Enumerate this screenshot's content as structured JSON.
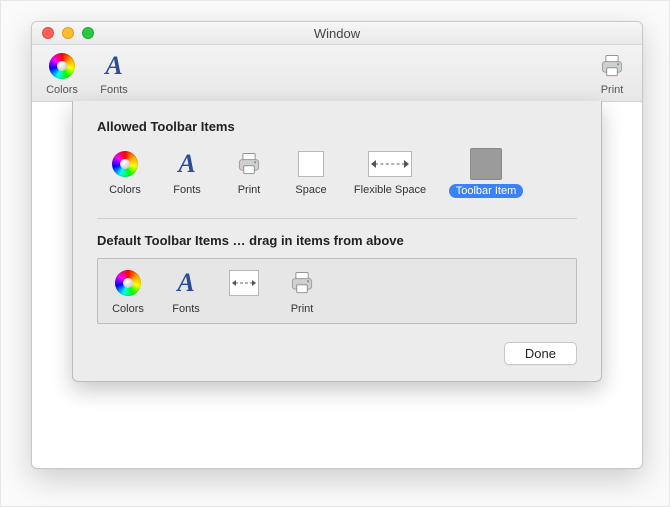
{
  "window": {
    "title": "Window"
  },
  "toolbar": {
    "items": [
      {
        "label": "Colors",
        "icon": "colors-icon"
      },
      {
        "label": "Fonts",
        "icon": "fonts-icon"
      }
    ],
    "right": [
      {
        "label": "Print",
        "icon": "print-icon"
      }
    ]
  },
  "sheet": {
    "allowed_title": "Allowed Toolbar Items",
    "allowed": [
      {
        "label": "Colors",
        "icon": "colors-icon"
      },
      {
        "label": "Fonts",
        "icon": "fonts-icon"
      },
      {
        "label": "Print",
        "icon": "print-icon"
      },
      {
        "label": "Space",
        "icon": "space-icon"
      },
      {
        "label": "Flexible Space",
        "icon": "flexible-space-icon"
      },
      {
        "label": "Toolbar Item",
        "icon": "generic-toolbar-item-icon",
        "selected": true
      }
    ],
    "default_title": "Default Toolbar Items … drag in items from above",
    "default": [
      {
        "label": "Colors",
        "icon": "colors-icon"
      },
      {
        "label": "Fonts",
        "icon": "fonts-icon"
      },
      {
        "label": "",
        "icon": "flexible-space-icon"
      },
      {
        "label": "Print",
        "icon": "print-icon"
      }
    ],
    "done_label": "Done"
  }
}
